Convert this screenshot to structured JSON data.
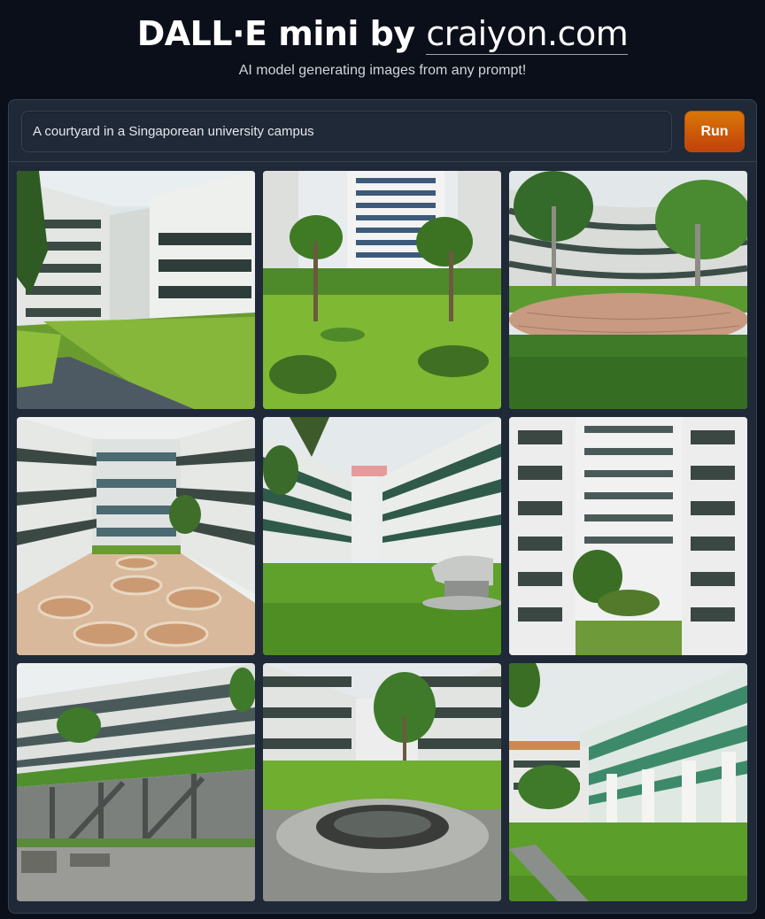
{
  "header": {
    "title_main": "DALL·E mini by ",
    "title_brand": "craiyon.com",
    "subtitle": "AI model generating images from any prompt!"
  },
  "prompt": {
    "value": "A courtyard in a Singaporean university campus"
  },
  "run_button": {
    "label": "Run"
  },
  "gallery": {
    "image_count": 9
  },
  "colors": {
    "background": "#0b0f19",
    "panel": "#1f2937",
    "accent": "#d97706"
  }
}
